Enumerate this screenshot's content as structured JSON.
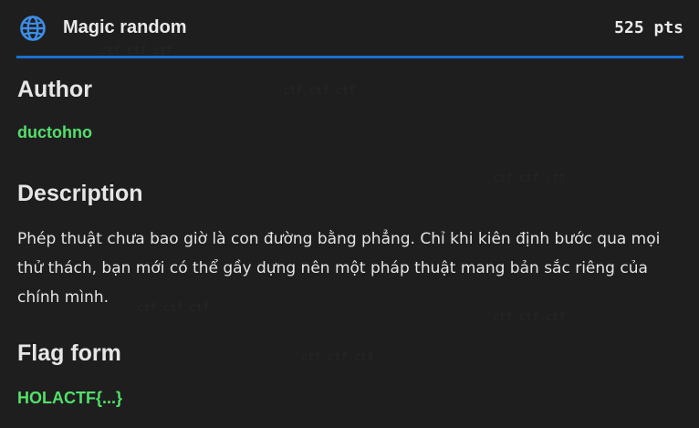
{
  "challenge": {
    "title": "Magic random",
    "points": "525 pts",
    "icon": "globe-icon",
    "accent_color": "#1b6fd1",
    "value_color": "#53e06a"
  },
  "author": {
    "heading": "Author",
    "name": "ductohno"
  },
  "description": {
    "heading": "Description",
    "text": "Phép thuật chưa bao giờ là con đường bằng phẳng. Chỉ khi kiên định bước qua mọi thử thách, bạn mới có thể gầy dựng nên một pháp thuật mang bản sắc riêng của chính mình."
  },
  "flag_form": {
    "heading": "Flag form",
    "value": "HOLACTF{...}"
  }
}
